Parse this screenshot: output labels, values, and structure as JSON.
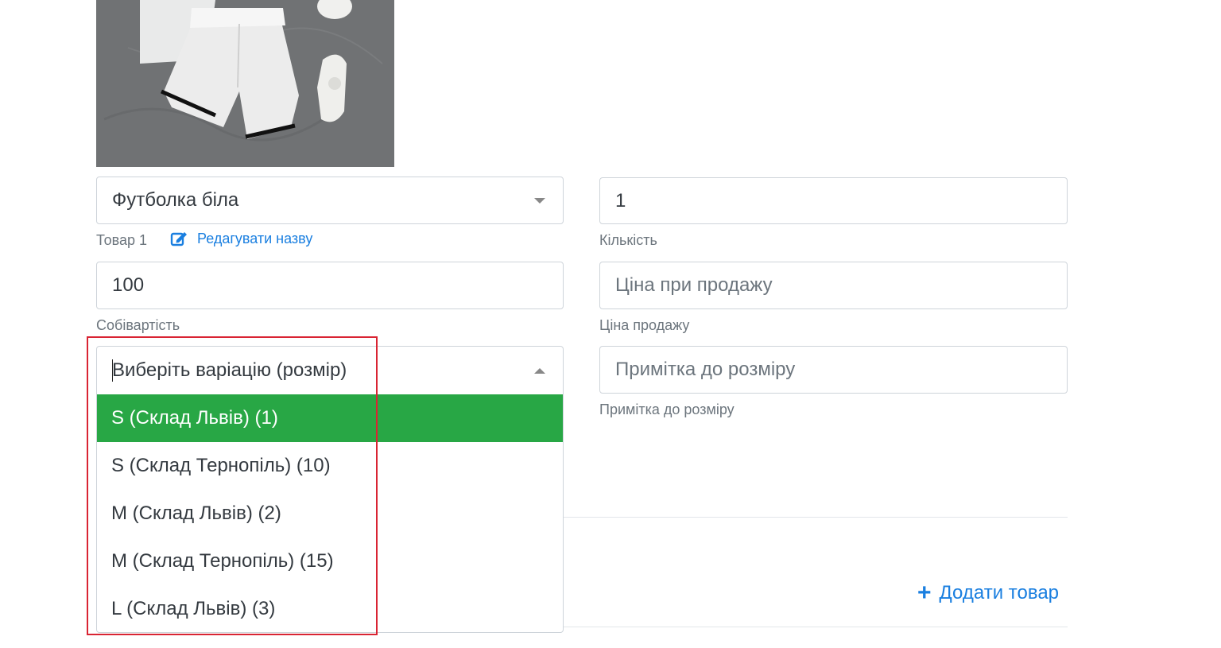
{
  "product": {
    "name_value": "Футболка біла",
    "label": "Товар 1",
    "edit_name_link": "Редагувати назву"
  },
  "quantity": {
    "value": "1",
    "label": "Кількість"
  },
  "cost": {
    "value": "100",
    "label": "Собівартість"
  },
  "sale_price": {
    "placeholder": "Ціна при продажу",
    "label": "Ціна продажу"
  },
  "size_note": {
    "placeholder": "Примітка до розміру",
    "label": "Примітка до розміру"
  },
  "variation": {
    "search_placeholder": "Виберіть варіацію (розмір)",
    "options": [
      "S (Склад Львів) (1)",
      "S (Склад Тернопіль) (10)",
      "M (Склад Львів) (2)",
      "M (Склад Тернопіль) (15)",
      "L (Склад Львів) (3)"
    ],
    "active_index": 0
  },
  "actions": {
    "add_product": "Додати товар"
  },
  "colors": {
    "accent": "#1a7fe0",
    "option_highlight": "#28a745",
    "annotation_frame": "#d92433"
  }
}
